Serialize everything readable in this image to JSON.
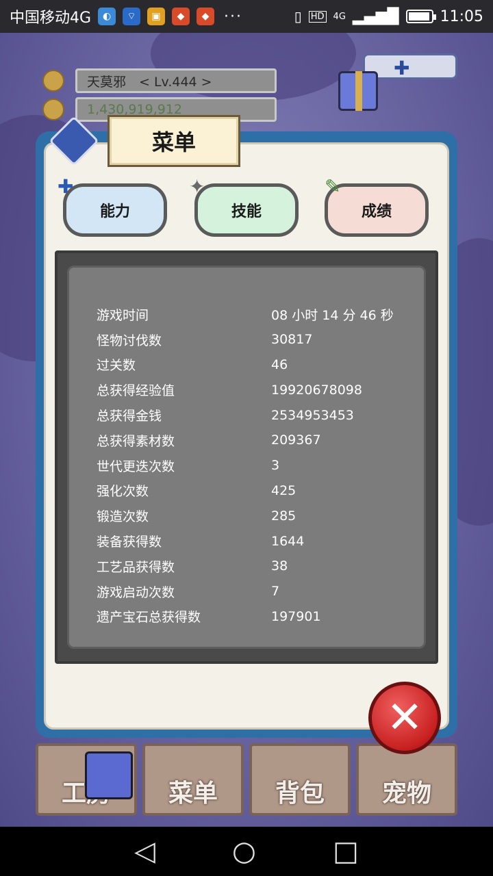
{
  "status_bar": {
    "carrier": "中国移动4G",
    "dots": "···",
    "network": "4G",
    "hd": "HD",
    "time": "11:05"
  },
  "hud": {
    "player": "天莫邪　< Lv.444 >",
    "gold": "1,430,919,912"
  },
  "menu": {
    "title": "菜单",
    "tabs": [
      {
        "label": "能力"
      },
      {
        "label": "技能"
      },
      {
        "label": "成绩"
      }
    ]
  },
  "stats": [
    {
      "label": "游戏时间",
      "value": "08 小时 14 分 46 秒"
    },
    {
      "label": "怪物讨伐数",
      "value": "30817"
    },
    {
      "label": "过关数",
      "value": "46"
    },
    {
      "label": "总获得经验值",
      "value": "19920678098"
    },
    {
      "label": "总获得金钱",
      "value": "2534953453"
    },
    {
      "label": "总获得素材数",
      "value": "209367"
    },
    {
      "label": "世代更迭次数",
      "value": "3"
    },
    {
      "label": "强化次数",
      "value": "425"
    },
    {
      "label": "锻造次数",
      "value": "285"
    },
    {
      "label": "装备获得数",
      "value": "1644"
    },
    {
      "label": "工艺品获得数",
      "value": "38"
    },
    {
      "label": "游戏启动次数",
      "value": "7"
    },
    {
      "label": "遗产宝石总获得数",
      "value": "197901"
    }
  ],
  "bottom_nav": [
    {
      "label": "工房"
    },
    {
      "label": "菜单"
    },
    {
      "label": "背包"
    },
    {
      "label": "宠物"
    }
  ],
  "icons": {
    "close": "close-icon",
    "back": "back-icon",
    "home": "home-icon",
    "recents": "recents-icon"
  }
}
